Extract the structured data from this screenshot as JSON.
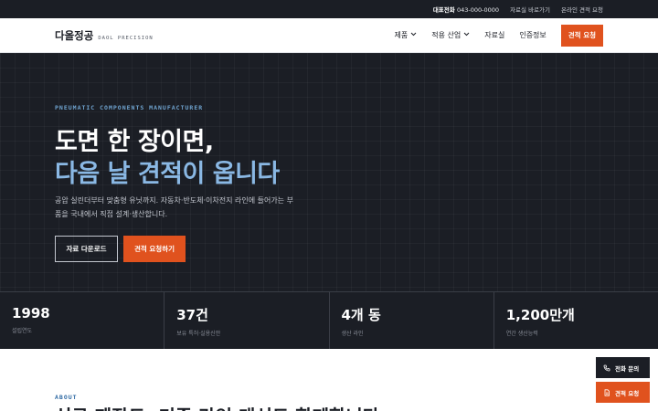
{
  "topbar": {
    "phone_label": "대표전화",
    "phone_number": "043-000-0000",
    "link_catalog": "자료실 바로가기",
    "link_quote": "온라인 견적 요청"
  },
  "header": {
    "brand_ko": "다올정공",
    "brand_en": "DAOL PRECISION",
    "nav": {
      "products": "제품",
      "applications": "적용 산업",
      "resources": "자료실",
      "certifications": "인증정보",
      "cta": "견적 요청"
    }
  },
  "hero": {
    "eyebrow": "PNEUMATIC COMPONENTS MANUFACTURER",
    "title_line1": "도면 한 장이면,",
    "title_line2": "다음 날 견적이 옵니다",
    "lead": "공압 실린더부터 맞춤형 유닛까지. 자동차·반도체·이차전지 라인에 들어가는 부품을 국내에서 직접 설계·생산합니다.",
    "btn_download": "자료 다운로드",
    "btn_quote": "견적 요청하기"
  },
  "stats": [
    {
      "value": "1998",
      "label": "설립연도"
    },
    {
      "value": "37건",
      "label": "보유 특허·실용신안"
    },
    {
      "value": "4개 동",
      "label": "생산 라인"
    },
    {
      "value": "1,200만개",
      "label": "연간 생산능력"
    }
  ],
  "about": {
    "eyebrow": "ABOUT",
    "heading": "신규 제작도, 기존 라인 개선도 함께합니다"
  },
  "floating": {
    "call": "전화 문의",
    "quote": "견적 요청"
  },
  "colors": {
    "dark": "#1b1e25",
    "accent": "#e0521e",
    "highlight": "#8ab8e4"
  }
}
